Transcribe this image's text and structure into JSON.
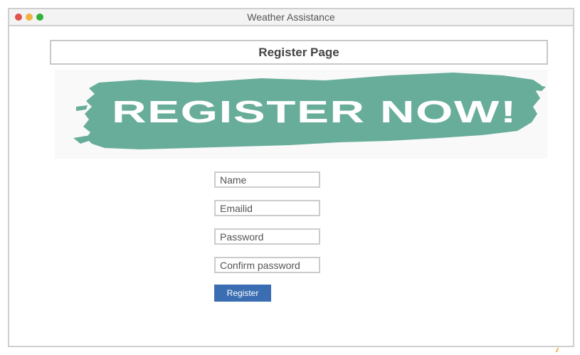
{
  "window": {
    "title": "Weather Assistance",
    "controls": [
      {
        "name": "close",
        "color": "#e0524f"
      },
      {
        "name": "minimize",
        "color": "#efb23c"
      },
      {
        "name": "maximize",
        "color": "#2db33a"
      }
    ]
  },
  "header": {
    "title": "Register Page"
  },
  "banner": {
    "text": "REGISTER NOW!",
    "brush_color": "#68ad9a",
    "text_color": "#ffffff"
  },
  "form": {
    "fields": [
      {
        "name": "name",
        "placeholder": "Name",
        "value": ""
      },
      {
        "name": "emailid",
        "placeholder": "Emailid",
        "value": ""
      },
      {
        "name": "password",
        "placeholder": "Password",
        "value": ""
      },
      {
        "name": "confirm_password",
        "placeholder": "Confirm password",
        "value": ""
      }
    ],
    "submit_label": "Register",
    "submit_color": "#3a6db2"
  }
}
